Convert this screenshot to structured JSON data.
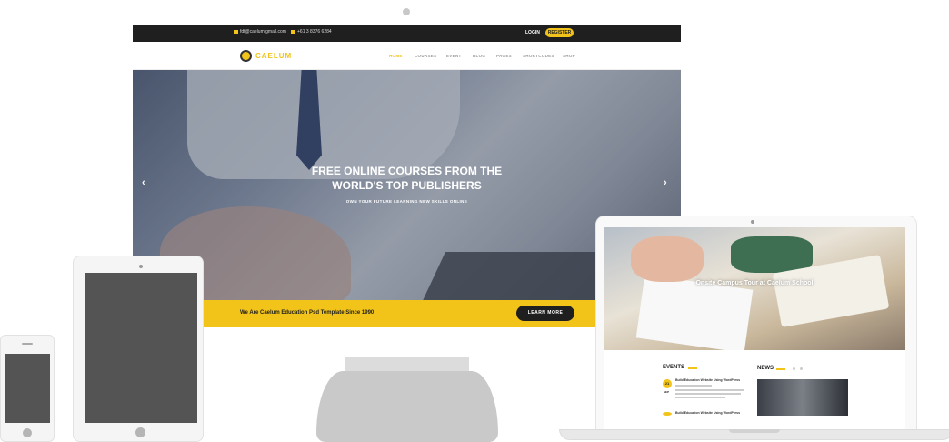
{
  "topbar": {
    "email": "fdt@caelum.gmail.com",
    "phone": "+61 3 8376 6284",
    "login": "LOGIN",
    "register": "REGISTER"
  },
  "brand": {
    "name": "CAELUM",
    "logo_icon": "owl-icon"
  },
  "nav": [
    "HOME",
    "COURSES",
    "EVENT",
    "BLOG",
    "PAGES",
    "SHORTCODES",
    "SHOP"
  ],
  "hero": {
    "title_line1": "FREE ONLINE COURSES FROM THE",
    "title_line2": "WORLD'S TOP PUBLISHERS",
    "subtitle": "OWN YOUR FUTURE LEARNING NEW SKILLS ONLINE",
    "prev_icon": "chevron-left-icon",
    "next_icon": "chevron-right-icon"
  },
  "cta": {
    "text": "We Are Caelum Education Psd Template Since 1990",
    "button": "LEARN MORE"
  },
  "laptop": {
    "hero_caption": "Onsite Campus Tour at Caelum School",
    "events_heading": "EVENTS",
    "news_heading": "NEWS",
    "event1": {
      "day": "21",
      "month": "SEP",
      "title": "Build Education Website Using WordPress"
    },
    "event2": {
      "title": "Build Education Website Using WordPress"
    }
  },
  "colors": {
    "accent": "#f2c318",
    "dark": "#1f1f1f",
    "device_screen": "#545454"
  }
}
